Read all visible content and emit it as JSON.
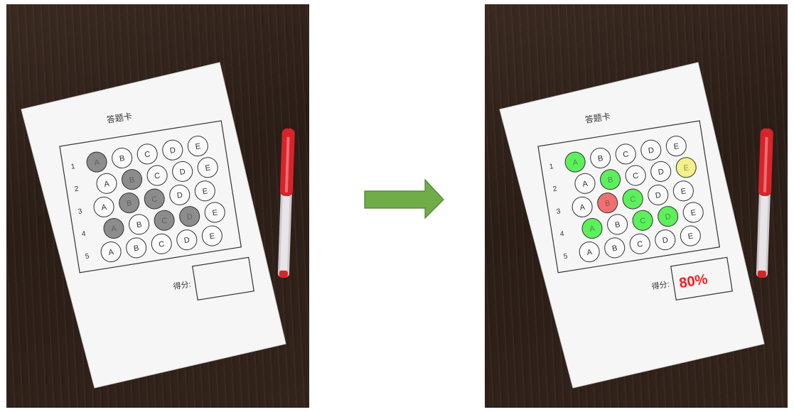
{
  "sheet": {
    "title": "答题卡",
    "score_label": "得分:",
    "row_numbers": [
      "1",
      "2",
      "3",
      "4",
      "5"
    ],
    "options": [
      "A",
      "B",
      "C",
      "D",
      "E"
    ]
  },
  "before": {
    "marked_answers": [
      {
        "row": 1,
        "option": "A"
      },
      {
        "row": 2,
        "option": "B"
      },
      {
        "row": 3,
        "option": "B"
      },
      {
        "row": 3,
        "option": "C"
      },
      {
        "row": 4,
        "option": "A"
      },
      {
        "row": 4,
        "option": "C"
      },
      {
        "row": 4,
        "option": "D"
      }
    ],
    "fill_color": "#8c8c8c"
  },
  "after": {
    "graded_answers": [
      {
        "row": 1,
        "option": "A",
        "status": "correct"
      },
      {
        "row": 2,
        "option": "B",
        "status": "correct"
      },
      {
        "row": 2,
        "option": "E",
        "status": "missed"
      },
      {
        "row": 3,
        "option": "B",
        "status": "wrong"
      },
      {
        "row": 3,
        "option": "C",
        "status": "correct"
      },
      {
        "row": 4,
        "option": "A",
        "status": "correct"
      },
      {
        "row": 4,
        "option": "C",
        "status": "correct"
      },
      {
        "row": 4,
        "option": "D",
        "status": "correct"
      }
    ],
    "score": "80%",
    "colors": {
      "correct": "#5cf05c",
      "wrong": "#f07070",
      "missed": "#f4f08a",
      "score": "#ff1a1a"
    }
  },
  "arrow_color": "#70ad47",
  "pen_color": "#d8232a"
}
